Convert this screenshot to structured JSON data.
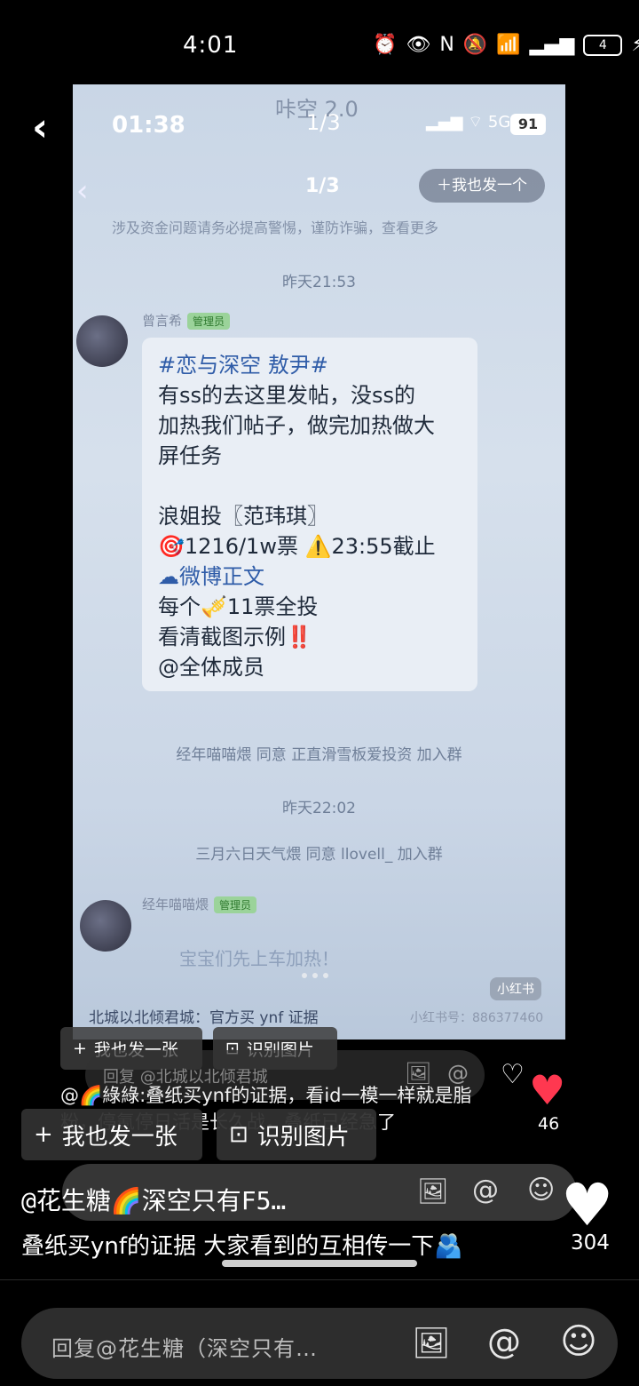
{
  "status": {
    "time": "4:01",
    "battery": "4"
  },
  "photo": {
    "top_bar": {
      "time": "01:38",
      "counter": "1/3",
      "app_title": "咔空 2.0"
    },
    "inner_counter": "1/3",
    "inner_pill": "＋我也发一个",
    "warning": "涉及资金问题请务必提高警惕，谨防诈骗，查看更多",
    "timestamp1": "昨天21:53",
    "sender1": "曾言希",
    "sender1_badge": "管理员",
    "bubble_lines": [
      "#恋与深空 敖尹#",
      "有ss的去这里发帖，没ss的",
      "加热我们帖子，做完加热做大",
      "屏任务",
      "",
      "浪姐投〖范玮琪〗",
      "🎯1216/1w票 ⚠️23:55截止",
      "☁微博正文",
      "每个🎺11票全投",
      "看清截图示例‼️",
      "@全体成员"
    ],
    "sys1": "经年喵喵煨 同意 正直滑雪板爱投资 加入群",
    "timestamp2": "昨天22:02",
    "sys2": "三月六日天气煨 同意 llovell_ 加入群",
    "sender2": "经年喵喵煨",
    "sender2_badge": "管理员",
    "sender2_line": "宝宝们先上车加热！",
    "tag": "小红书",
    "footer_note": "北城以北倾君城：官方买 ynf 证据",
    "footer_id": "小红书号：886377460"
  },
  "nav": {
    "back": "‹",
    "time": "01:38",
    "counter": "1/3",
    "status_battery": "91"
  },
  "chips_small": [
    {
      "icon": "+",
      "label": "我也发一张"
    },
    {
      "icon": "⊡",
      "label": "识别图片"
    }
  ],
  "reply_small_placeholder": "回复 @北城以北倾君城",
  "comment_small": {
    "text": "@🌈綠綠:叠纸买ynf的证据，看id一模一样就是脂粉，停氪停日活是长久战，叠纸已经急了",
    "likes": "46"
  },
  "chips_big": [
    {
      "icon": "+",
      "label": "我也发一张"
    },
    {
      "icon": "⊡",
      "label": "识别图片"
    }
  ],
  "comment_big": {
    "author": "@花生糖🌈深空只有F5…",
    "text": "叠纸买ynf的证据 大家看到的互相传一下🫂",
    "likes": "304"
  },
  "bottom": {
    "placeholder": "回复@花生糖（深空只有…"
  }
}
